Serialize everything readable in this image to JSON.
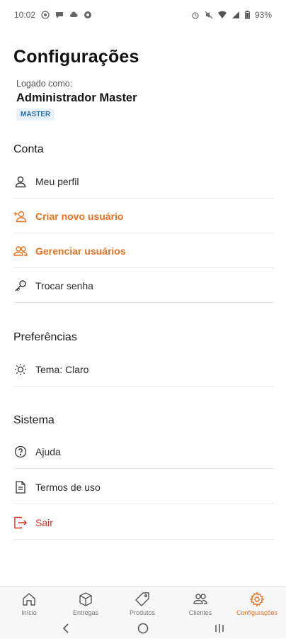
{
  "status_bar": {
    "time": "10:02",
    "battery": "93%"
  },
  "page": {
    "title": "Configurações"
  },
  "account": {
    "logged_label": "Logado como:",
    "name": "Administrador Master",
    "role": "MASTER"
  },
  "sections": {
    "conta": {
      "title": "Conta",
      "items": [
        {
          "label": "Meu perfil",
          "icon": "user-icon"
        },
        {
          "label": "Criar novo usuário",
          "icon": "user-plus-icon"
        },
        {
          "label": "Gerenciar usuários",
          "icon": "users-icon"
        },
        {
          "label": "Trocar senha",
          "icon": "key-icon"
        }
      ]
    },
    "preferencias": {
      "title": "Preferências",
      "items": [
        {
          "label": "Tema: Claro",
          "icon": "sun-icon"
        }
      ]
    },
    "sistema": {
      "title": "Sistema",
      "items": [
        {
          "label": "Ajuda",
          "icon": "help-circle-icon"
        },
        {
          "label": "Termos de uso",
          "icon": "document-icon"
        },
        {
          "label": "Sair",
          "icon": "logout-icon"
        }
      ]
    }
  },
  "bottom_nav": {
    "active": "Configurações",
    "items": [
      {
        "label": "Início",
        "icon": "home-icon"
      },
      {
        "label": "Entregas",
        "icon": "box-icon"
      },
      {
        "label": "Produtos",
        "icon": "tag-icon"
      },
      {
        "label": "Clientes",
        "icon": "users-icon"
      },
      {
        "label": "Configurações",
        "icon": "gear-icon"
      }
    ]
  },
  "colors": {
    "accent": "#e8701f",
    "danger": "#d93025",
    "badge_bg": "#e7f2fb",
    "badge_text": "#2c6fa8"
  }
}
